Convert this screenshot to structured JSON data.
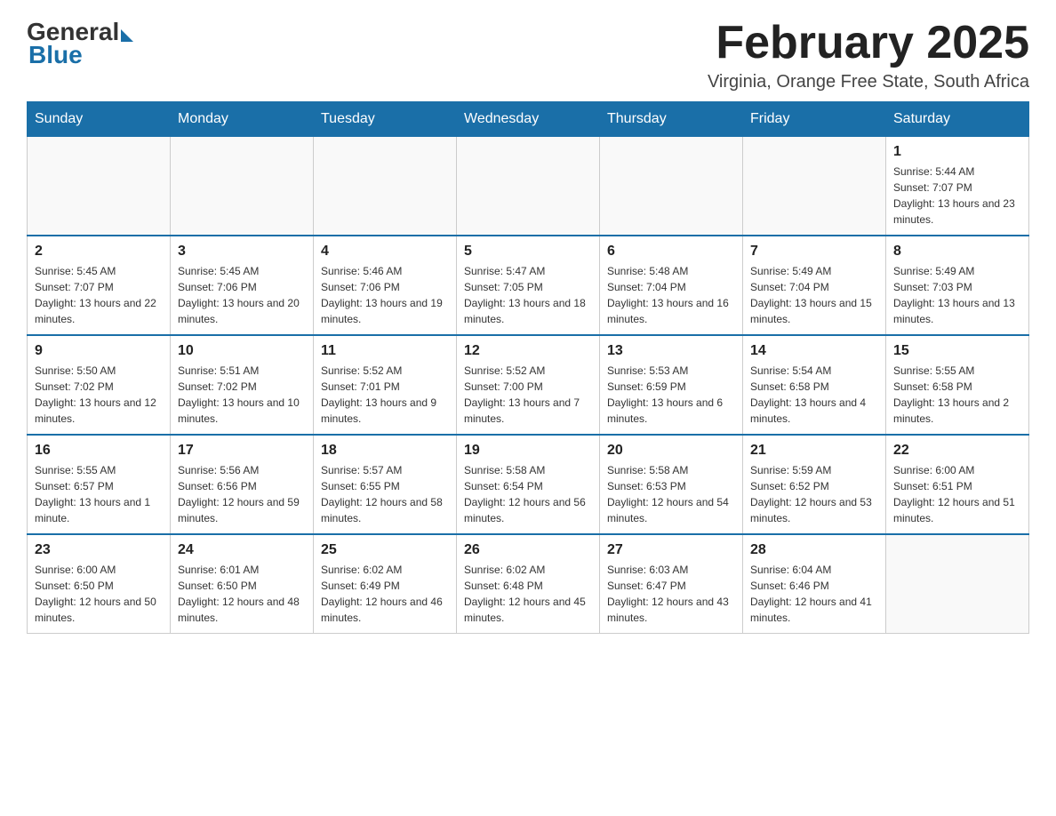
{
  "logo": {
    "general": "General",
    "blue": "Blue"
  },
  "header": {
    "month": "February 2025",
    "location": "Virginia, Orange Free State, South Africa"
  },
  "weekdays": [
    "Sunday",
    "Monday",
    "Tuesday",
    "Wednesday",
    "Thursday",
    "Friday",
    "Saturday"
  ],
  "weeks": [
    [
      {
        "day": "",
        "info": ""
      },
      {
        "day": "",
        "info": ""
      },
      {
        "day": "",
        "info": ""
      },
      {
        "day": "",
        "info": ""
      },
      {
        "day": "",
        "info": ""
      },
      {
        "day": "",
        "info": ""
      },
      {
        "day": "1",
        "info": "Sunrise: 5:44 AM\nSunset: 7:07 PM\nDaylight: 13 hours and 23 minutes."
      }
    ],
    [
      {
        "day": "2",
        "info": "Sunrise: 5:45 AM\nSunset: 7:07 PM\nDaylight: 13 hours and 22 minutes."
      },
      {
        "day": "3",
        "info": "Sunrise: 5:45 AM\nSunset: 7:06 PM\nDaylight: 13 hours and 20 minutes."
      },
      {
        "day": "4",
        "info": "Sunrise: 5:46 AM\nSunset: 7:06 PM\nDaylight: 13 hours and 19 minutes."
      },
      {
        "day": "5",
        "info": "Sunrise: 5:47 AM\nSunset: 7:05 PM\nDaylight: 13 hours and 18 minutes."
      },
      {
        "day": "6",
        "info": "Sunrise: 5:48 AM\nSunset: 7:04 PM\nDaylight: 13 hours and 16 minutes."
      },
      {
        "day": "7",
        "info": "Sunrise: 5:49 AM\nSunset: 7:04 PM\nDaylight: 13 hours and 15 minutes."
      },
      {
        "day": "8",
        "info": "Sunrise: 5:49 AM\nSunset: 7:03 PM\nDaylight: 13 hours and 13 minutes."
      }
    ],
    [
      {
        "day": "9",
        "info": "Sunrise: 5:50 AM\nSunset: 7:02 PM\nDaylight: 13 hours and 12 minutes."
      },
      {
        "day": "10",
        "info": "Sunrise: 5:51 AM\nSunset: 7:02 PM\nDaylight: 13 hours and 10 minutes."
      },
      {
        "day": "11",
        "info": "Sunrise: 5:52 AM\nSunset: 7:01 PM\nDaylight: 13 hours and 9 minutes."
      },
      {
        "day": "12",
        "info": "Sunrise: 5:52 AM\nSunset: 7:00 PM\nDaylight: 13 hours and 7 minutes."
      },
      {
        "day": "13",
        "info": "Sunrise: 5:53 AM\nSunset: 6:59 PM\nDaylight: 13 hours and 6 minutes."
      },
      {
        "day": "14",
        "info": "Sunrise: 5:54 AM\nSunset: 6:58 PM\nDaylight: 13 hours and 4 minutes."
      },
      {
        "day": "15",
        "info": "Sunrise: 5:55 AM\nSunset: 6:58 PM\nDaylight: 13 hours and 2 minutes."
      }
    ],
    [
      {
        "day": "16",
        "info": "Sunrise: 5:55 AM\nSunset: 6:57 PM\nDaylight: 13 hours and 1 minute."
      },
      {
        "day": "17",
        "info": "Sunrise: 5:56 AM\nSunset: 6:56 PM\nDaylight: 12 hours and 59 minutes."
      },
      {
        "day": "18",
        "info": "Sunrise: 5:57 AM\nSunset: 6:55 PM\nDaylight: 12 hours and 58 minutes."
      },
      {
        "day": "19",
        "info": "Sunrise: 5:58 AM\nSunset: 6:54 PM\nDaylight: 12 hours and 56 minutes."
      },
      {
        "day": "20",
        "info": "Sunrise: 5:58 AM\nSunset: 6:53 PM\nDaylight: 12 hours and 54 minutes."
      },
      {
        "day": "21",
        "info": "Sunrise: 5:59 AM\nSunset: 6:52 PM\nDaylight: 12 hours and 53 minutes."
      },
      {
        "day": "22",
        "info": "Sunrise: 6:00 AM\nSunset: 6:51 PM\nDaylight: 12 hours and 51 minutes."
      }
    ],
    [
      {
        "day": "23",
        "info": "Sunrise: 6:00 AM\nSunset: 6:50 PM\nDaylight: 12 hours and 50 minutes."
      },
      {
        "day": "24",
        "info": "Sunrise: 6:01 AM\nSunset: 6:50 PM\nDaylight: 12 hours and 48 minutes."
      },
      {
        "day": "25",
        "info": "Sunrise: 6:02 AM\nSunset: 6:49 PM\nDaylight: 12 hours and 46 minutes."
      },
      {
        "day": "26",
        "info": "Sunrise: 6:02 AM\nSunset: 6:48 PM\nDaylight: 12 hours and 45 minutes."
      },
      {
        "day": "27",
        "info": "Sunrise: 6:03 AM\nSunset: 6:47 PM\nDaylight: 12 hours and 43 minutes."
      },
      {
        "day": "28",
        "info": "Sunrise: 6:04 AM\nSunset: 6:46 PM\nDaylight: 12 hours and 41 minutes."
      },
      {
        "day": "",
        "info": ""
      }
    ]
  ]
}
